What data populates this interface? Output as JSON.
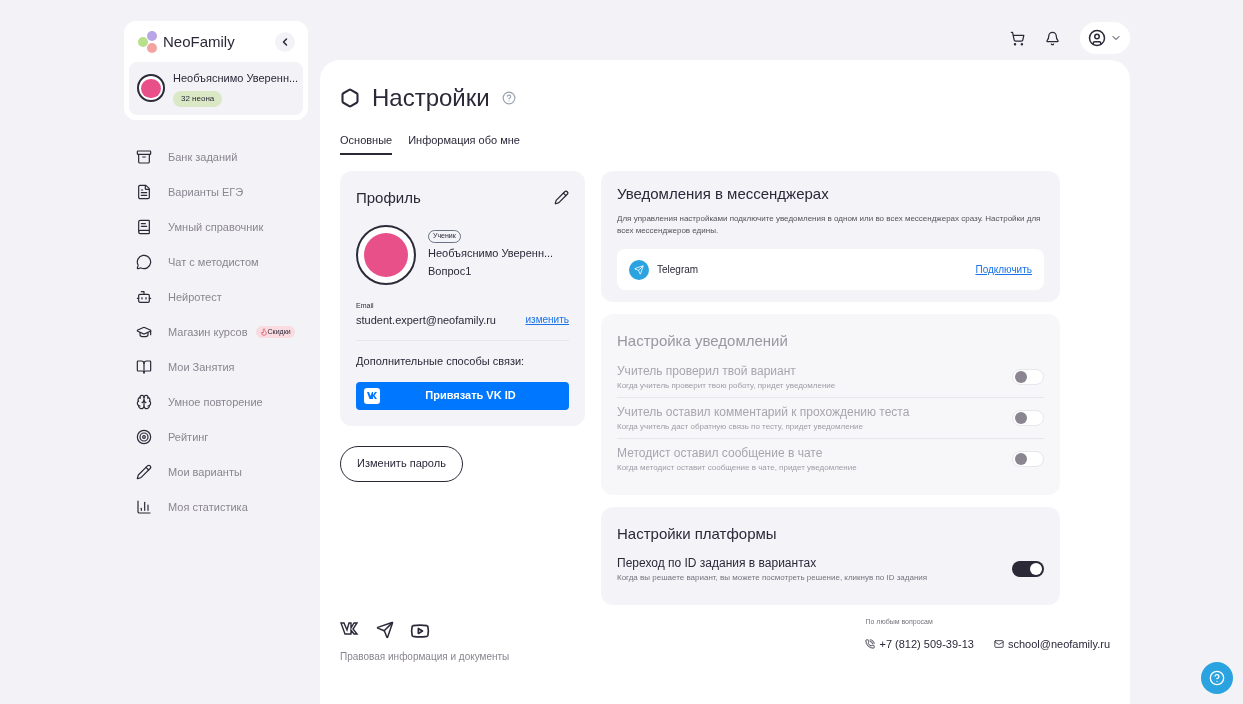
{
  "brand": {
    "name": "NeoFamily"
  },
  "user": {
    "name": "Необъяснимо Уверенн...",
    "balance": "32 неона"
  },
  "nav": [
    {
      "label": "Банк заданий"
    },
    {
      "label": "Варианты ЕГЭ"
    },
    {
      "label": "Умный справочник"
    },
    {
      "label": "Чат с методистом"
    },
    {
      "label": "Нейротест"
    },
    {
      "label": "Магазин курсов",
      "badge": "Скидки"
    },
    {
      "label": "Мои Занятия"
    },
    {
      "label": "Умное повторение"
    },
    {
      "label": "Рейтинг"
    },
    {
      "label": "Мои варианты"
    },
    {
      "label": "Моя статистика"
    }
  ],
  "page": {
    "title": "Настройки"
  },
  "tabs": [
    {
      "label": "Основные",
      "selected": true
    },
    {
      "label": "Информация обо мне",
      "selected": false
    }
  ],
  "profile": {
    "title": "Профиль",
    "role": "Ученик",
    "name": "Необъяснимо Уверенн...",
    "nickname": "Вопрос1",
    "email_label": "Email",
    "email": "student.expert@neofamily.ru",
    "change_link": "изменить",
    "extra_label": "Дополнительные способы связи:",
    "vk_button": "Привязать VK ID"
  },
  "change_password": "Изменить пароль",
  "messengers": {
    "title": "Уведомления в мессенджерах",
    "description": "Для управления настройками подключите уведомления в одном или во всех мессенджерах сразу. Настройки для всех мессенджеров едины.",
    "items": [
      {
        "name": "Telegram",
        "action": "Подключить"
      }
    ]
  },
  "notifications": {
    "title": "Настройка уведомлений",
    "disabled": true,
    "items": [
      {
        "title": "Учитель проверил твой вариант",
        "hint": "Когда учитель проверит твою роботу, придет уведомление",
        "on": false
      },
      {
        "title": "Учитель оставил комментарий к прохождению теста",
        "hint": "Когда учитель даст обратную связь по тесту, придет уведомление",
        "on": false
      },
      {
        "title": "Методист оставил сообщение в чате",
        "hint": "Когда методист оставит сообщение в чате, придет уведомление",
        "on": false
      }
    ]
  },
  "platform": {
    "title": "Настройки платформы",
    "disabled": false,
    "items": [
      {
        "title": "Переход по ID задания в вариантах",
        "hint": "Когда вы решаете вариант, вы можете посмотреть решение, кликнув по ID задания",
        "on": true
      }
    ]
  },
  "footer": {
    "contact_label": "По любым вопросам",
    "phone": "+7 (812) 509-39-13",
    "email": "school@neofamily.ru",
    "legal": "Правовая информация и документы"
  }
}
